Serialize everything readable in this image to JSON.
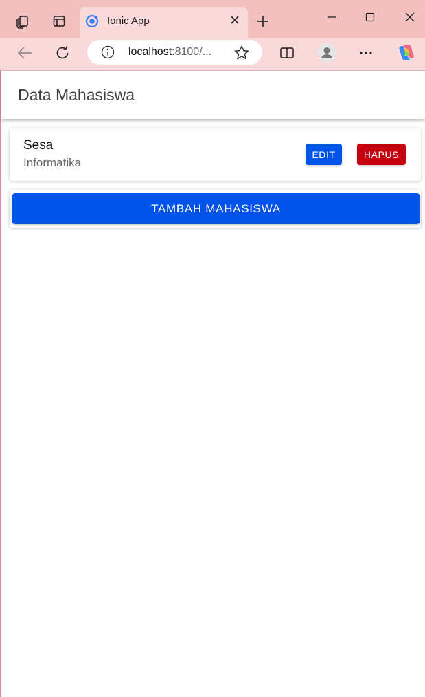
{
  "browser": {
    "tab": {
      "title": "Ionic App"
    },
    "address": {
      "host": "localhost",
      "path": ":8100/..."
    },
    "colors": {
      "chrome": "#f3c0c0",
      "active": "#f9d9d9"
    },
    "icons": [
      "workspaces-icon",
      "tab-actions-icon",
      "ionic-favicon-icon",
      "close-icon",
      "new-tab-icon",
      "minimize-icon",
      "maximize-icon",
      "window-close-icon",
      "back-icon",
      "refresh-icon",
      "site-info-icon",
      "favorite-star-icon",
      "split-screen-icon",
      "profile-icon",
      "more-icon",
      "copilot-icon"
    ]
  },
  "app": {
    "title": "Data Mahasiswa",
    "students": [
      {
        "name": "Sesa",
        "major": "Informatika",
        "edit_label": "EDIT",
        "delete_label": "HAPUS"
      }
    ],
    "add_button_label": "TAMBAH MAHASISWA",
    "colors": {
      "primary": "#0054e9",
      "danger": "#c5000f"
    }
  }
}
